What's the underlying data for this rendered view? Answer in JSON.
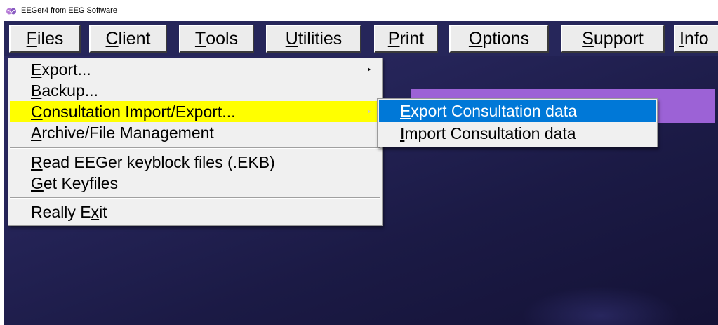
{
  "window": {
    "title": "EEGer4 from EEG Software",
    "icon": "brain-waves-icon"
  },
  "colors": {
    "workspace": "#26265a",
    "menu_highlight": "#ffff00",
    "submenu_selected": "#0078d7",
    "purple_panel": "#9c62d6"
  },
  "menubar": {
    "files": {
      "mnemonic": "F",
      "rest": "iles"
    },
    "client": {
      "mnemonic": "C",
      "rest": "lient"
    },
    "tools": {
      "mnemonic": "T",
      "rest": "ools"
    },
    "utilities": {
      "mnemonic": "U",
      "rest": "tilities"
    },
    "print": {
      "mnemonic": "P",
      "rest": "rint"
    },
    "options": {
      "mnemonic": "O",
      "rest": "ptions"
    },
    "support": {
      "mnemonic": "S",
      "rest": "upport"
    },
    "info": {
      "mnemonic": "I",
      "rest": "nfo"
    }
  },
  "files_menu": {
    "export": {
      "mnemonic": "E",
      "rest": "xport..."
    },
    "backup": {
      "mnemonic": "B",
      "rest": "ackup..."
    },
    "consultation": {
      "mnemonic": "C",
      "rest": "onsultation Import/Export..."
    },
    "archive": {
      "mnemonic": "A",
      "rest": "rchive/File Management"
    },
    "read_keyblock": {
      "mnemonic": "R",
      "rest": "ead EEGer keyblock files (.EKB)"
    },
    "get_keyfiles": {
      "mnemonic": "G",
      "rest": "et Keyfiles"
    },
    "really_exit": {
      "before": "Really E",
      "mnemonic": "x",
      "rest": "it"
    }
  },
  "consultation_submenu": {
    "export_data": {
      "mnemonic": "E",
      "rest": "xport Consultation data"
    },
    "import_data": {
      "mnemonic": "I",
      "rest": "mport Consultation data"
    }
  }
}
